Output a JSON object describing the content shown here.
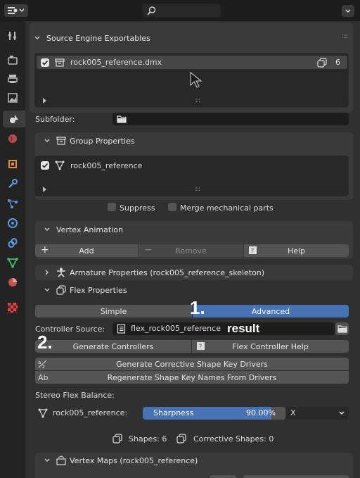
{
  "panels": {
    "source_engine": {
      "title": "Source Engine Exportables",
      "list_item": {
        "name": "rock005_reference.dmx",
        "count": "6"
      },
      "subfolder_label": "Subfolder:"
    },
    "group_properties": {
      "title": "Group Properties",
      "list_item": {
        "name": "rock005_reference"
      },
      "suppress_label": "Suppress",
      "merge_label": "Merge mechanical parts"
    },
    "vertex_animation": {
      "title": "Vertex Animation",
      "add_label": "Add",
      "remove_label": "Remove",
      "help_label": "Help"
    },
    "armature_properties": {
      "title": "Armature Properties (rock005_reference_skeleton)"
    },
    "flex_properties": {
      "title": "Flex Properties",
      "mode_simple": "Simple",
      "mode_advanced": "Advanced",
      "controller_source_label": "Controller Source:",
      "controller_source_value": "flex_rock005_reference",
      "generate_controllers": "Generate Controllers",
      "flex_controller_help": "Flex Controller Help",
      "generate_corrective": "Generate Corrective Shape Key Drivers",
      "regenerate_names": "Regenerate Shape Key Names From Drivers",
      "stereo_label": "Stereo Flex Balance:",
      "stereo_object": "rock005_reference:",
      "sharpness_label": "Sharpness",
      "sharpness_value": "90.00%",
      "sharpness_fraction": 0.9,
      "axis_value": "X",
      "shapes_label": "Shapes: 6",
      "corrective_label": "Corrective Shapes: 0"
    },
    "vertex_maps": {
      "title": "Vertex Maps (rock005_reference)"
    }
  },
  "annotations": {
    "one": "1.",
    "two": "2.",
    "result": "result"
  },
  "colors": {
    "accent": "#4772b3",
    "bg": "#303030",
    "panel": "#3a3a3a"
  }
}
